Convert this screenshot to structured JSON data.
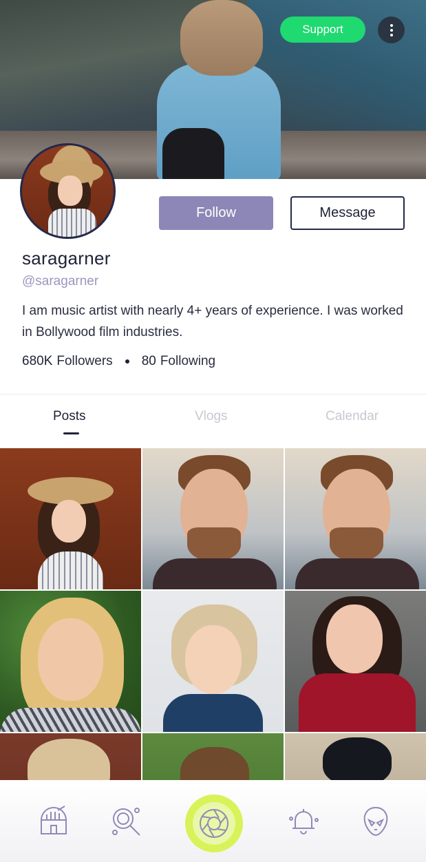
{
  "header": {
    "support_label": "Support",
    "more_icon": "more-vertical-icon"
  },
  "profile": {
    "follow_label": "Follow",
    "message_label": "Message",
    "username": "saragarner",
    "handle": "@saragarner",
    "bio": "I am music artist with nearly 4+ years of experience. I was worked in Bollywood film industries.",
    "followers_count": "680K",
    "followers_label": "Followers",
    "following_count": "80",
    "following_label": "Following"
  },
  "tabs": [
    {
      "label": "Posts",
      "active": true
    },
    {
      "label": "Vlogs",
      "active": false
    },
    {
      "label": "Calendar",
      "active": false
    }
  ],
  "bottom_nav": [
    {
      "icon": "observatory-icon"
    },
    {
      "icon": "search-planet-icon"
    },
    {
      "icon": "camera-aperture-icon"
    },
    {
      "icon": "bell-icon"
    },
    {
      "icon": "alien-icon"
    }
  ],
  "colors": {
    "support_green": "#1fd971",
    "follow_purple": "#8c87b6",
    "handle_purple": "#9a97bd",
    "accent_lime": "#d8f25a",
    "navy": "#23294a"
  }
}
